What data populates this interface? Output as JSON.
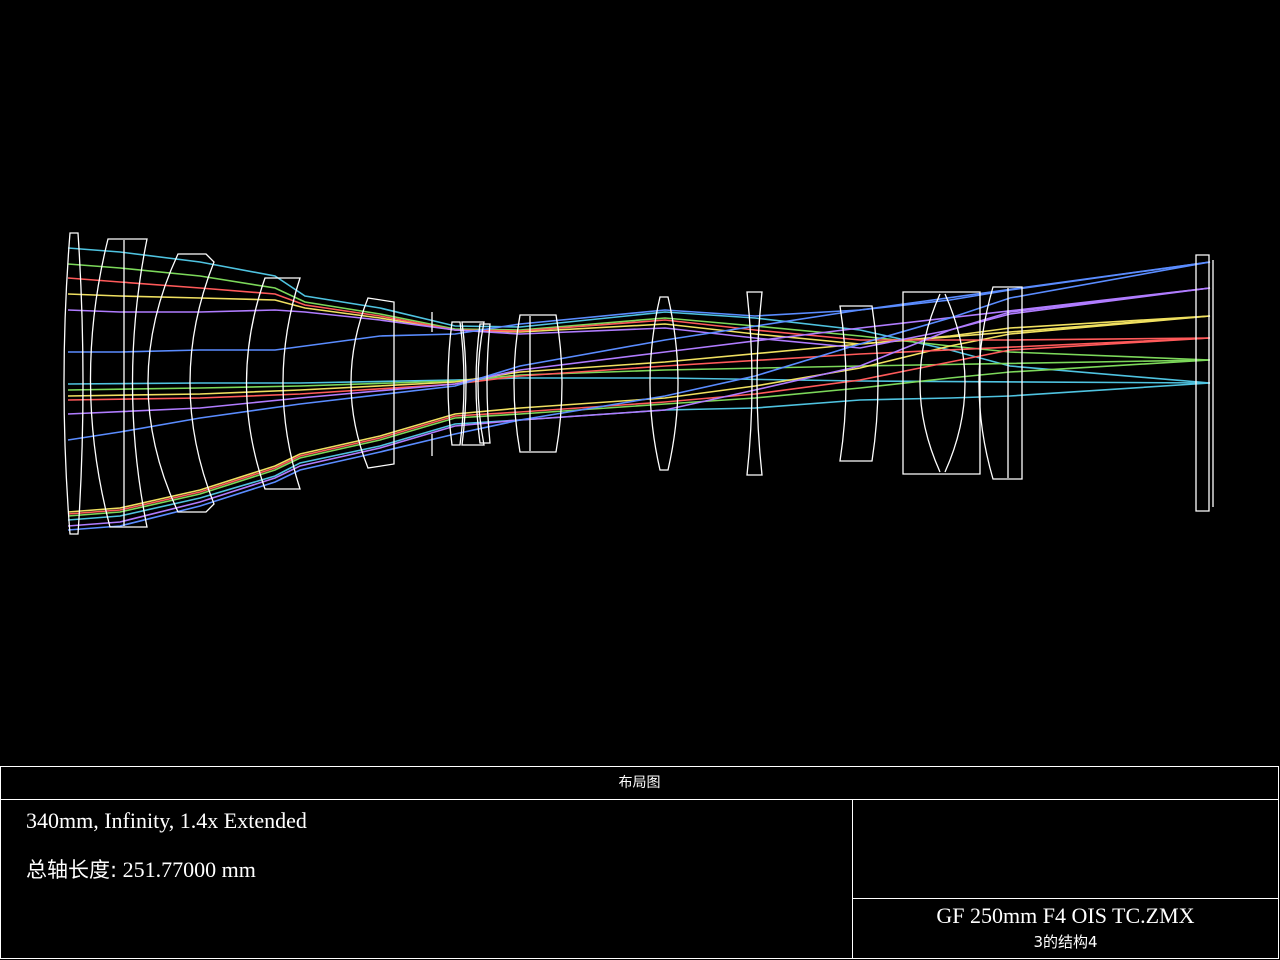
{
  "panel": {
    "title": "布局图",
    "description": "340mm, Infinity, 1.4x Extended",
    "total_length_label": "总轴长度:",
    "total_length_value": "251.77000 mm",
    "file_name": "GF 250mm F4 OIS TC.ZMX",
    "configuration": "3的结构4"
  },
  "colors": {
    "background": "#000000",
    "lens_outline": "#ffffff",
    "ray_fields": [
      "#4fc3e0",
      "#7cd85a",
      "#f0e060",
      "#ff5a5a",
      "#b07cff",
      "#5a8cff"
    ]
  }
}
